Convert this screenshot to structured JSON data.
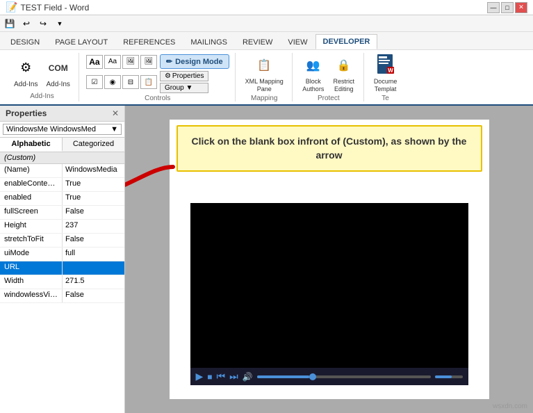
{
  "titleBar": {
    "title": "TEST Field - Word",
    "controls": [
      "—",
      "□",
      "✕"
    ]
  },
  "quickAccess": {
    "icons": [
      "💾",
      "↩",
      "↪",
      "⊞"
    ]
  },
  "ribbonTabs": [
    {
      "label": "DESIGN",
      "active": false
    },
    {
      "label": "PAGE LAYOUT",
      "active": false
    },
    {
      "label": "REFERENCES",
      "active": false
    },
    {
      "label": "MAILINGS",
      "active": false
    },
    {
      "label": "REVIEW",
      "active": false
    },
    {
      "label": "VIEW",
      "active": false
    },
    {
      "label": "DEVELOPER",
      "active": true
    }
  ],
  "ribbon": {
    "groups": [
      {
        "label": "Add-Ins",
        "items": [
          {
            "label": "Add-Ins",
            "icon": "⚙"
          },
          {
            "label": "COM\nAdd-Ins",
            "icon": "COM"
          }
        ]
      },
      {
        "label": "Controls",
        "designMode": "Design Mode",
        "properties": "Properties",
        "group": "Group ▼"
      },
      {
        "label": "Mapping",
        "items": [
          {
            "label": "XML Mapping\nPane",
            "icon": "📋"
          }
        ]
      },
      {
        "label": "Protect",
        "items": [
          {
            "label": "Block\nAuthors",
            "icon": "🔒"
          },
          {
            "label": "Restrict\nEditing",
            "icon": "🔒"
          }
        ]
      },
      {
        "label": "Te",
        "items": [
          {
            "label": "Docume\nTempla",
            "icon": "📄"
          }
        ]
      }
    ]
  },
  "propertiesPanel": {
    "title": "Properties",
    "closeLabel": "✕",
    "dropdown": {
      "value": "WindowsMe",
      "displayValue": "WindowsMe WindowsMed"
    },
    "tabs": [
      {
        "label": "Alphabetic",
        "active": true
      },
      {
        "label": "Categorized",
        "active": false
      }
    ],
    "customRow": "(Custom)",
    "rows": [
      {
        "key": "(Name)",
        "value": "WindowsMedia",
        "selected": false
      },
      {
        "key": "enableContextM",
        "value": "True",
        "selected": false
      },
      {
        "key": "enabled",
        "value": "True",
        "selected": false
      },
      {
        "key": "fullScreen",
        "value": "False",
        "selected": false
      },
      {
        "key": "Height",
        "value": "237",
        "selected": false
      },
      {
        "key": "stretchToFit",
        "value": "False",
        "selected": false
      },
      {
        "key": "uiMode",
        "value": "full",
        "selected": false
      },
      {
        "key": "URL",
        "value": "",
        "selected": true
      },
      {
        "key": "Width",
        "value": "271.5",
        "selected": false
      },
      {
        "key": "windowlessVide",
        "value": "False",
        "selected": false
      }
    ]
  },
  "annotation": {
    "text": "Click on the blank box infront of\n(Custom), as shown by the arrow"
  },
  "watermark": "wsxdn.com"
}
